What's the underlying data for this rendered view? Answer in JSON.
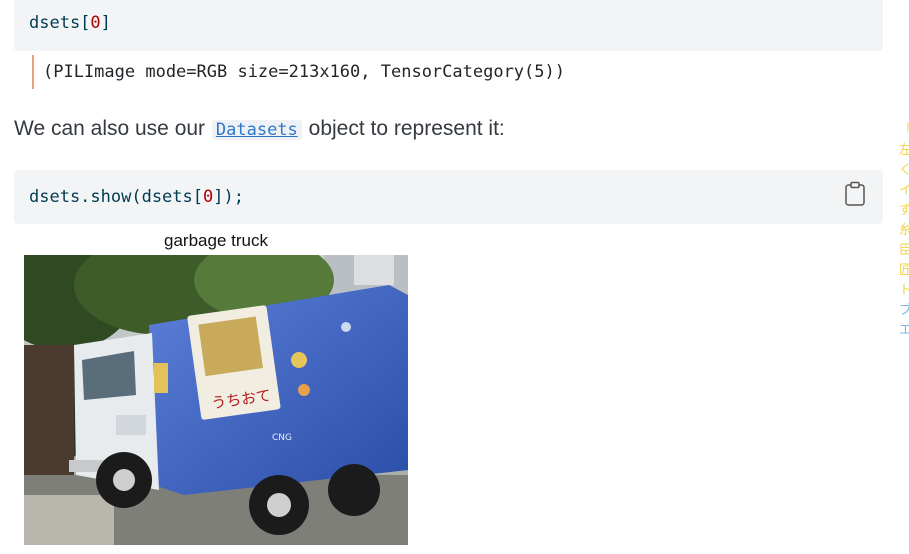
{
  "cell1": {
    "code_prefix": "dsets[",
    "code_index": "0",
    "code_suffix": "]"
  },
  "output": {
    "text": "(PILImage mode=RGB size=213x160, TensorCategory(5))"
  },
  "prose": {
    "before": "We can also use our",
    "link": "Datasets",
    "after": "object to represent it:"
  },
  "cell2": {
    "code_prefix": "dsets.show(dsets[",
    "code_index": "0",
    "code_suffix": "]);"
  },
  "figure": {
    "title": "garbage truck",
    "sign_text": "うちおて",
    "cng_text": "CNG"
  },
  "side_glyphs": [
    "「",
    "左",
    "く",
    "イ",
    "ず",
    "糸",
    "臣",
    "匠",
    "ト",
    "ブ",
    "エ"
  ],
  "colors": {
    "code_bg": "#f3f4f6",
    "code_text": "#003b4f",
    "number": "#ad0000",
    "output_rule": "#e8a37a",
    "link": "#2e78c7"
  },
  "icons": {
    "copy": "clipboard-icon"
  }
}
